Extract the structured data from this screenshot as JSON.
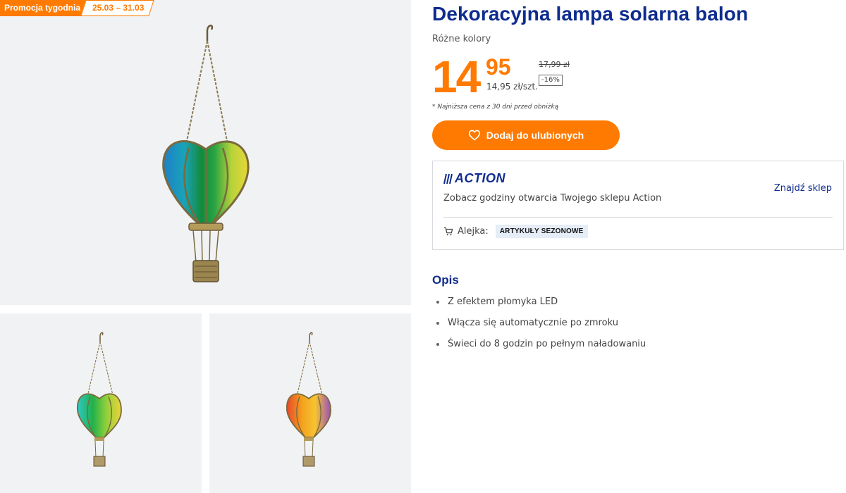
{
  "promo": {
    "label": "Promocja tygodnia",
    "dates": "25.03 – 31.03"
  },
  "gallery": {
    "images": [
      {
        "name": "balloon-lamp-blue-yellow"
      },
      {
        "name": "balloon-lamp-blue-green-yellow"
      },
      {
        "name": "balloon-lamp-orange-purple"
      }
    ]
  },
  "product": {
    "title": "Dekoracyjna lampa solarna balon",
    "subtitle": "Różne kolory"
  },
  "price": {
    "integer": "14",
    "decimals": "95",
    "unit": "14,95 zł/szt.",
    "old": "17,99 zł",
    "discount": "-16%",
    "note": "* Najniższa cena z 30 dni przed obniżką"
  },
  "favorite_button": {
    "label": "Dodaj do ulubionych",
    "icon": "heart-icon"
  },
  "store": {
    "logo": "ACTION",
    "text": "Zobacz godziny otwarcia Twojego sklepu Action",
    "find_link": "Znajdź sklep",
    "aisle_label": "Alejka:",
    "aisle_value": "ARTYKUŁY SEZONOWE",
    "aisle_icon": "cart-icon"
  },
  "description": {
    "title": "Opis",
    "items": [
      "Z efektem płomyka LED",
      "Włącza się automatycznie po zmroku",
      "Świeci do 8 godzin po pełnym naładowaniu"
    ]
  },
  "colors": {
    "brand_blue": "#0e2c8e",
    "accent_orange": "#ff7a00",
    "background_grey": "#f1f2f4"
  }
}
